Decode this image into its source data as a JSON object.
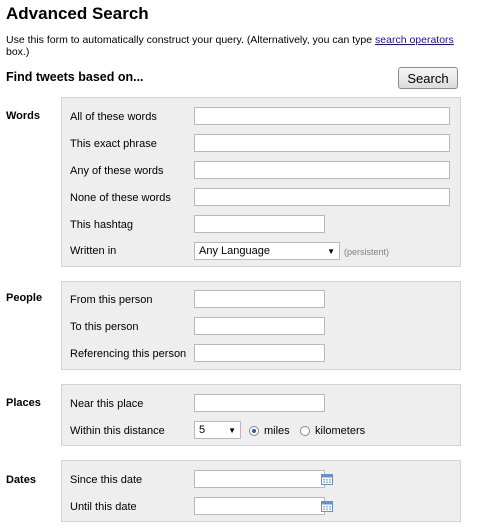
{
  "header": {
    "title": "Advanced Search",
    "intro_text": "Use this form to automatically construct your query. (Alternatively, you can type ",
    "intro_link": "search operators",
    "intro_suffix": "box.)",
    "find_label": "Find tweets based on...",
    "search_button": "Search"
  },
  "words": {
    "section_label": "Words",
    "all_label": "All of these words",
    "all_value": "",
    "exact_label": "This exact phrase",
    "exact_value": "",
    "any_label": "Any of these words",
    "any_value": "",
    "none_label": "None of these words",
    "none_value": "",
    "hashtag_label": "This hashtag",
    "hashtag_value": "",
    "language_label": "Written in",
    "language_value": "Any Language",
    "language_note": "(persistent)"
  },
  "people": {
    "section_label": "People",
    "from_label": "From this person",
    "from_value": "",
    "to_label": "To this person",
    "to_value": "",
    "ref_label": "Referencing this person",
    "ref_value": ""
  },
  "places": {
    "section_label": "Places",
    "near_label": "Near this place",
    "near_value": "",
    "distance_label": "Within this distance",
    "distance_value": "5",
    "unit_miles": "miles",
    "unit_km": "kilometers",
    "selected_unit": "miles"
  },
  "dates": {
    "section_label": "Dates",
    "since_label": "Since this date",
    "since_value": "",
    "until_label": "Until this date",
    "until_value": "",
    "calendar_icon": "calendar-icon"
  },
  "colors": {
    "link": "#1a0dab",
    "panel_bg": "#eeeeee",
    "panel_border": "#d4d4d4",
    "note_gray": "#808080",
    "calendar_blue": "#6b8fc9"
  }
}
